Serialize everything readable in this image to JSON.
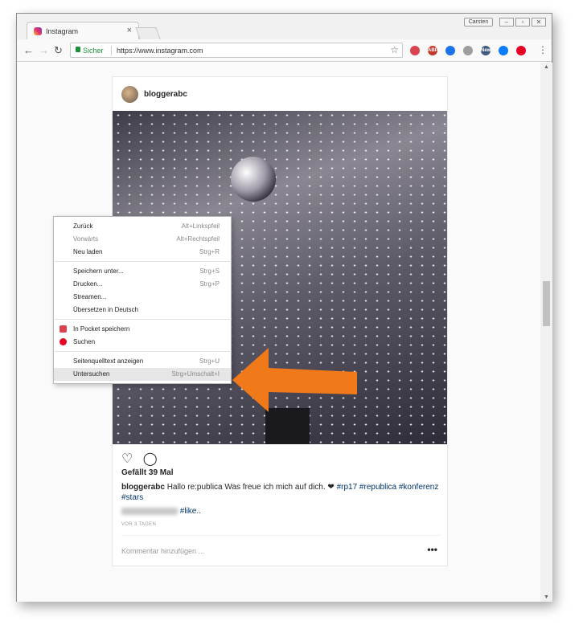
{
  "browser": {
    "tab_title": "Instagram",
    "tab_close": "×",
    "profile_button": "Carsten",
    "address": {
      "secure_label": "Sicher",
      "url": "https://www.instagram.com"
    },
    "extensions": [
      {
        "name": "pocket-icon",
        "color": "#d9434f",
        "label": ""
      },
      {
        "name": "adblock-icon",
        "color": "#c0392b",
        "label": "ABP"
      },
      {
        "name": "ring-icon",
        "color": "#1a73e8",
        "label": ""
      },
      {
        "name": "gray-circle-icon",
        "color": "#9e9e9e",
        "label": ""
      },
      {
        "name": "new-badge-icon",
        "color": "#3d5a80",
        "label": "New"
      },
      {
        "name": "messenger-icon",
        "color": "#0a7cff",
        "label": ""
      },
      {
        "name": "pinterest-icon",
        "color": "#e60023",
        "label": ""
      }
    ]
  },
  "post": {
    "username": "bloggerabc",
    "likes": "Gefällt 39 Mal",
    "caption_user": "bloggerabc",
    "caption_text": "Hallo re:publica Was freue ich mich auf dich. ❤",
    "caption_tags": "#rp17 #republica #konferenz #stars",
    "blurred_suffix": "#like..",
    "time_ago": "VOR 3 TAGEN",
    "comment_placeholder": "Kommentar hinzufügen ...",
    "more": "•••"
  },
  "context_menu": {
    "items": [
      {
        "label": "Zurück",
        "shortcut": "Alt+Linkspfeil",
        "disabled": false
      },
      {
        "label": "Vorwärts",
        "shortcut": "Alt+Rechtspfeil",
        "disabled": true
      },
      {
        "label": "Neu laden",
        "shortcut": "Strg+R",
        "disabled": false
      },
      {
        "label": "Speichern unter...",
        "shortcut": "Strg+S",
        "disabled": false
      },
      {
        "label": "Drucken...",
        "shortcut": "Strg+P",
        "disabled": false
      },
      {
        "label": "Streamen...",
        "shortcut": "",
        "disabled": false
      },
      {
        "label": "Übersetzen in Deutsch",
        "shortcut": "",
        "disabled": false
      },
      {
        "label": "In Pocket speichern",
        "shortcut": "",
        "disabled": false
      },
      {
        "label": "Suchen",
        "shortcut": "",
        "disabled": false
      },
      {
        "label": "Seitenquelltext anzeigen",
        "shortcut": "Strg+U",
        "disabled": false
      },
      {
        "label": "Untersuchen",
        "shortcut": "Strg+Umschalt+I",
        "disabled": false
      }
    ]
  },
  "colors": {
    "arrow": "#f07a1a",
    "secure": "#1b8f3a",
    "hashtag": "#003569"
  }
}
